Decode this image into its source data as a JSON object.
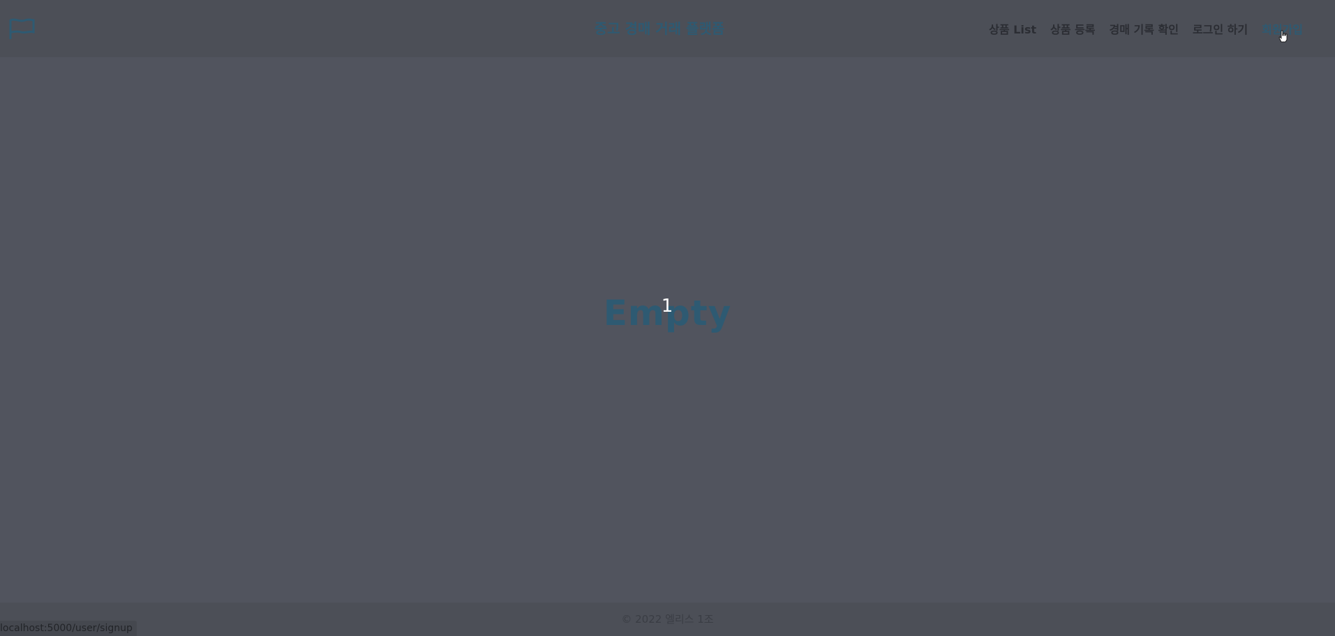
{
  "header": {
    "logo_icon": "flag-icon",
    "brand_title": "중고 경매 거래 플랫폼",
    "nav": {
      "items": [
        {
          "label": "상품 List"
        },
        {
          "label": "상품 등록"
        },
        {
          "label": "경매 기록 확인"
        },
        {
          "label": "로그인 하기"
        },
        {
          "label": "회원가입"
        }
      ],
      "active_index": 4
    }
  },
  "main": {
    "empty_label": "Empty",
    "count": "1"
  },
  "footer": {
    "copyright": "© 2022 엘리스 1조"
  },
  "status_bar": {
    "url": "localhost:5000/user/signup"
  },
  "colors": {
    "background": "#51545e",
    "accent": "#2e5a72",
    "nav_text": "#2b2d33"
  }
}
